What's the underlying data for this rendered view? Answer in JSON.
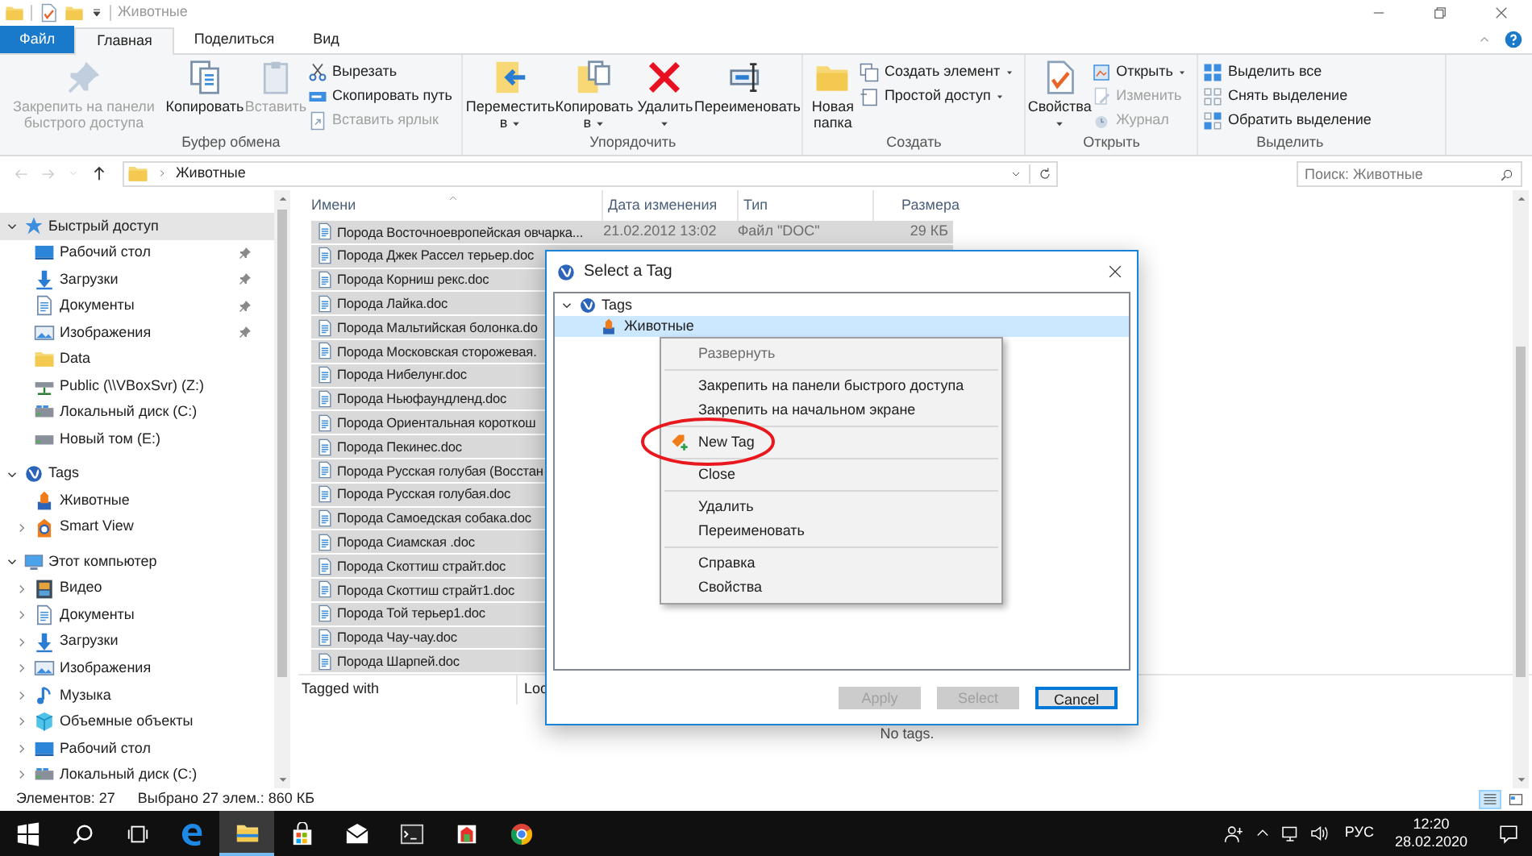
{
  "title_bar": {
    "title": "Животные"
  },
  "tabs": [
    {
      "label": "Файл",
      "kind": "file",
      "selected": false
    },
    {
      "label": "Главная",
      "kind": "tab",
      "selected": true
    },
    {
      "label": "Поделиться",
      "kind": "tab",
      "selected": false
    },
    {
      "label": "Вид",
      "kind": "tab",
      "selected": false
    }
  ],
  "ribbon": {
    "groups": [
      {
        "label": "Буфер обмена",
        "items": [
          {
            "kind": "large",
            "label": "Закрепить на панели быстрого доступа",
            "disabled": true,
            "dropdown": false
          },
          {
            "kind": "large",
            "label": "Копировать",
            "disabled": false,
            "dropdown": false
          },
          {
            "kind": "large",
            "label": "Вставить",
            "disabled": true,
            "dropdown": false
          },
          {
            "kind": "stack",
            "items": [
              {
                "label": "Вырезать",
                "disabled": false,
                "dropdown": false
              },
              {
                "label": "Скопировать путь",
                "disabled": false,
                "dropdown": false
              },
              {
                "label": "Вставить ярлык",
                "disabled": true,
                "dropdown": false
              }
            ]
          }
        ]
      },
      {
        "label": "Упорядочить",
        "items": [
          {
            "kind": "large",
            "label": "Переместить в",
            "disabled": false,
            "dropdown": true
          },
          {
            "kind": "large",
            "label": "Копировать в",
            "disabled": false,
            "dropdown": true
          },
          {
            "kind": "large",
            "label": "Удалить",
            "disabled": false,
            "dropdown": true
          },
          {
            "kind": "large",
            "label": "Переименовать",
            "disabled": false,
            "dropdown": false
          }
        ]
      },
      {
        "label": "Создать",
        "items": [
          {
            "kind": "large",
            "label": "Новая папка",
            "disabled": false
          },
          {
            "kind": "stack",
            "items": [
              {
                "label": "Создать элемент",
                "disabled": false,
                "dropdown": true
              },
              {
                "label": "Простой доступ",
                "disabled": false,
                "dropdown": true
              }
            ]
          }
        ]
      },
      {
        "label": "Открыть",
        "items": [
          {
            "kind": "large",
            "label": "Свойства",
            "disabled": false,
            "dropdown": true
          },
          {
            "kind": "stack",
            "items": [
              {
                "label": "Открыть",
                "disabled": false,
                "dropdown": true
              },
              {
                "label": "Изменить",
                "disabled": true,
                "dropdown": false
              },
              {
                "label": "Журнал",
                "disabled": true,
                "dropdown": false
              }
            ]
          }
        ]
      },
      {
        "label": "Выделить",
        "items": [
          {
            "kind": "stack",
            "items": [
              {
                "label": "Выделить все",
                "disabled": false,
                "dropdown": false
              },
              {
                "label": "Снять выделение",
                "disabled": false,
                "dropdown": false
              },
              {
                "label": "Обратить выделение",
                "disabled": false,
                "dropdown": false
              }
            ]
          }
        ]
      }
    ]
  },
  "address_bar": {
    "nav_buttons": [
      {
        "kind": "back",
        "disabled": true
      },
      {
        "kind": "forward",
        "disabled": true
      },
      {
        "kind": "recent",
        "disabled": true
      },
      {
        "kind": "up",
        "disabled": false
      }
    ],
    "path": [
      "Животные"
    ],
    "search": {
      "placeholder": "Поиск: Животные"
    }
  },
  "nav_pane": [
    {
      "label": "Быстрый доступ",
      "kind": "quick",
      "expanded": true,
      "selected": true,
      "children": [
        {
          "label": "Рабочий стол",
          "kind": "desktop",
          "pinned": true,
          "selected": false
        },
        {
          "label": "Загрузки",
          "kind": "downloads",
          "pinned": true,
          "selected": false
        },
        {
          "label": "Документы",
          "kind": "documents",
          "pinned": true,
          "selected": false
        },
        {
          "label": "Изображения",
          "kind": "pictures",
          "pinned": true,
          "selected": false
        },
        {
          "label": "Data",
          "kind": "folder",
          "pinned": false,
          "selected": false
        },
        {
          "label": "Public (\\\\VBoxSvr) (Z:)",
          "kind": "netdrive",
          "pinned": false,
          "selected": false
        },
        {
          "label": "Локальный диск (C:)",
          "kind": "sysdrive",
          "pinned": false,
          "selected": false
        },
        {
          "label": "Новый том (E:)",
          "kind": "drive",
          "pinned": false,
          "selected": false
        }
      ]
    },
    {
      "label": "Tags",
      "kind": "tags",
      "expanded": true,
      "selected": false,
      "children": [
        {
          "label": "Животные",
          "kind": "tag",
          "selected": false
        },
        {
          "label": "Smart View",
          "kind": "smartview",
          "expanded": false,
          "selected": false
        }
      ]
    },
    {
      "label": "Этот компьютер",
      "kind": "computer",
      "expanded": true,
      "selected": false,
      "children": [
        {
          "label": "Видео",
          "kind": "video",
          "expanded": false,
          "selected": false
        },
        {
          "label": "Документы",
          "kind": "documents",
          "expanded": false,
          "selected": false
        },
        {
          "label": "Загрузки",
          "kind": "downloads",
          "expanded": false,
          "selected": false
        },
        {
          "label": "Изображения",
          "kind": "pictures",
          "expanded": false,
          "selected": false
        },
        {
          "label": "Музыка",
          "kind": "music",
          "expanded": false,
          "selected": false
        },
        {
          "label": "Объемные объекты",
          "kind": "objects3d",
          "expanded": false,
          "selected": false
        },
        {
          "label": "Рабочий стол",
          "kind": "desktop",
          "expanded": false,
          "selected": false
        },
        {
          "label": "Локальный диск (C:)",
          "kind": "sysdrive",
          "expanded": false,
          "selected": false
        }
      ]
    }
  ],
  "file_list": {
    "columns": [
      "Имени",
      "Дата изменения",
      "Тип",
      "Размера"
    ],
    "rows": [
      {
        "name": "Порода Восточноевропейская овчарка...",
        "date": "21.02.2012 13:02",
        "type": "Файл \"DOC\"",
        "size": "29 КБ",
        "selected": true
      },
      {
        "name": "Порода Джек Рассел терьер.doc",
        "selected": true
      },
      {
        "name": "Порода Корниш рекс.doc",
        "selected": true
      },
      {
        "name": "Порода Лайка.doc",
        "selected": true
      },
      {
        "name": "Порода Мальтийская болонка.do",
        "selected": true
      },
      {
        "name": "Порода Московская сторожевая.",
        "selected": true
      },
      {
        "name": "Порода Нибелунг.doc",
        "selected": true
      },
      {
        "name": "Порода Ньюфаундленд.doc",
        "selected": true
      },
      {
        "name": "Порода Ориентальная короткош",
        "selected": true
      },
      {
        "name": "Порода Пекинес.doc",
        "selected": true
      },
      {
        "name": "Порода Русская голубая (Восстан",
        "selected": true
      },
      {
        "name": "Порода Русская голубая.doc",
        "selected": true
      },
      {
        "name": "Порода Самоедская собака.doc",
        "selected": true
      },
      {
        "name": "Порода Сиамская .doc",
        "selected": true
      },
      {
        "name": "Порода Скоттиш страйт.doc",
        "selected": true
      },
      {
        "name": "Порода Скоттиш страйт1.doc",
        "selected": true
      },
      {
        "name": "Порода Той терьер1.doc",
        "selected": true
      },
      {
        "name": "Порода Чау-чау.doc",
        "selected": true
      },
      {
        "name": "Порода Шарпей.doc",
        "selected": true
      }
    ]
  },
  "details_pane": {
    "columns": [
      "Tagged with",
      "Loc"
    ],
    "empty_text": "No tags."
  },
  "dialog": {
    "title": "Select a Tag",
    "tree": [
      {
        "label": "Tags",
        "expanded": true,
        "selected": false,
        "children": [
          {
            "label": "Животные",
            "selected": true
          }
        ]
      }
    ],
    "buttons": [
      {
        "label": "Apply",
        "disabled": true,
        "default": false
      },
      {
        "label": "Select",
        "disabled": true,
        "default": false
      },
      {
        "label": "Cancel",
        "disabled": false,
        "default": true
      }
    ]
  },
  "context_menu": {
    "groups": [
      [
        {
          "label": "Развернуть",
          "kind": "text",
          "disabled": true
        }
      ],
      [
        {
          "label": "Закрепить на панели быстрого доступа",
          "kind": "text",
          "disabled": false
        },
        {
          "label": "Закрепить на начальном экране",
          "kind": "text",
          "disabled": false
        }
      ],
      [
        {
          "label": "New Tag",
          "kind": "icon",
          "disabled": false
        }
      ],
      [
        {
          "label": "Close",
          "kind": "text",
          "disabled": false
        }
      ],
      [
        {
          "label": "Удалить",
          "kind": "text",
          "disabled": false
        },
        {
          "label": "Переименовать",
          "kind": "text",
          "disabled": false
        }
      ],
      [
        {
          "label": "Справка",
          "kind": "text",
          "disabled": false
        },
        {
          "label": "Свойства",
          "kind": "text",
          "disabled": false
        }
      ]
    ]
  },
  "status_bar": {
    "items_count": "Элементов: 27",
    "selection": "Выбрано 27 элем.: 860 КБ",
    "views": [
      {
        "kind": "details",
        "selected": true
      },
      {
        "kind": "tiles",
        "selected": false
      }
    ]
  },
  "taskbar": {
    "apps": [
      {
        "kind": "start",
        "active": false
      },
      {
        "kind": "search",
        "active": false
      },
      {
        "kind": "taskview",
        "active": false
      },
      {
        "kind": "edge",
        "active": false
      },
      {
        "kind": "explorer",
        "active": true
      },
      {
        "kind": "store",
        "active": false
      },
      {
        "kind": "mail",
        "active": false
      },
      {
        "kind": "terminal",
        "active": false
      },
      {
        "kind": "tagapp",
        "active": false
      },
      {
        "kind": "chrome",
        "active": false
      }
    ],
    "language": "РУС",
    "time": "12:20",
    "date": "28.02.2020"
  }
}
